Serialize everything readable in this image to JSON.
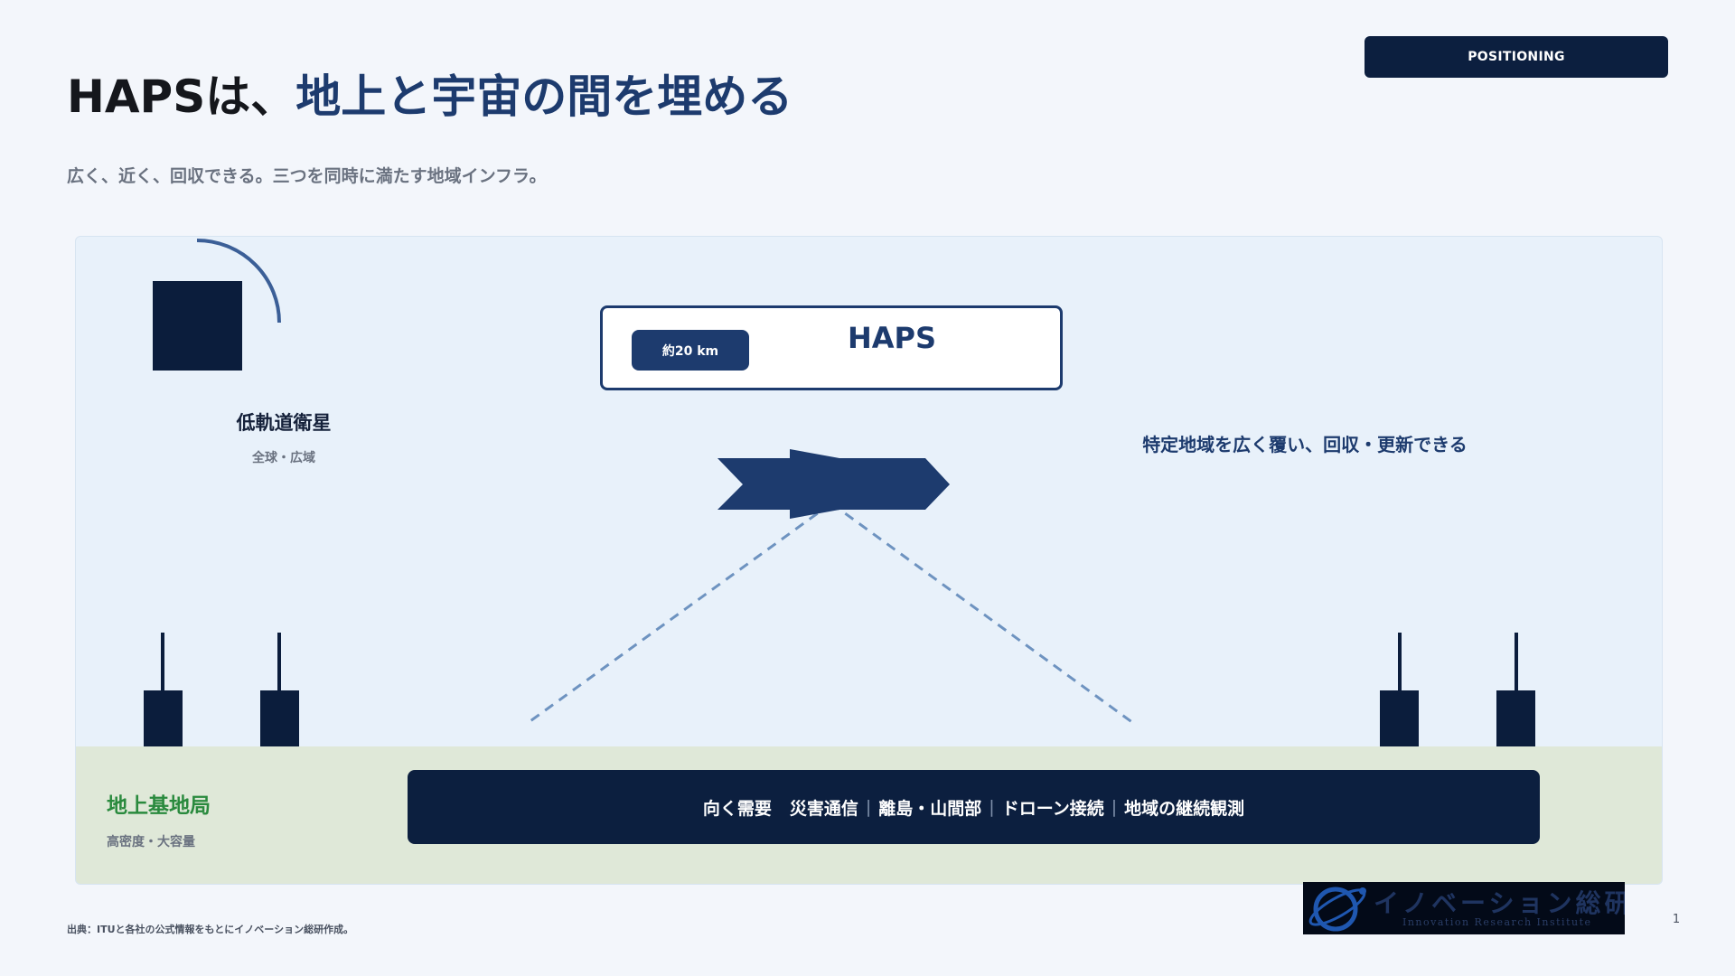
{
  "header": {
    "badge": "POSITIONING",
    "title_dark": "HAPSは、",
    "title_accent": "地上と宇宙の間を埋める",
    "subtitle": "広く、近く、回収できる。三つを同時に満たす地域インフラ。"
  },
  "satellite": {
    "label": "低軌道衛星",
    "sub": "全球・広域",
    "icon": "satellite-square-icon"
  },
  "haps": {
    "altitude": "約20 km",
    "name": "HAPS",
    "description": "特定地域を広く覆い、回収・更新できる",
    "icon": "haps-aircraft-icon"
  },
  "ground": {
    "label": "地上基地局",
    "sub": "高密度・大容量",
    "icon": "base-station-icon"
  },
  "needs": {
    "lead": "向く需要",
    "items": [
      "災害通信",
      "離島・山間部",
      "ドローン接続",
      "地域の継続観測"
    ]
  },
  "footer": {
    "source": "出典：ITUと各社の公式情報をもとにイノベーション総研作成。",
    "logo_jp": "イノベーション総研",
    "logo_en": "Innovation Research Institute",
    "page": "1"
  },
  "colors": {
    "navy": "#0c1f3f",
    "accent_blue": "#1d3b6e",
    "ground_green": "#2a8a3e",
    "sky": "#e8f1fa",
    "ground_fill": "#dfe8d8"
  }
}
